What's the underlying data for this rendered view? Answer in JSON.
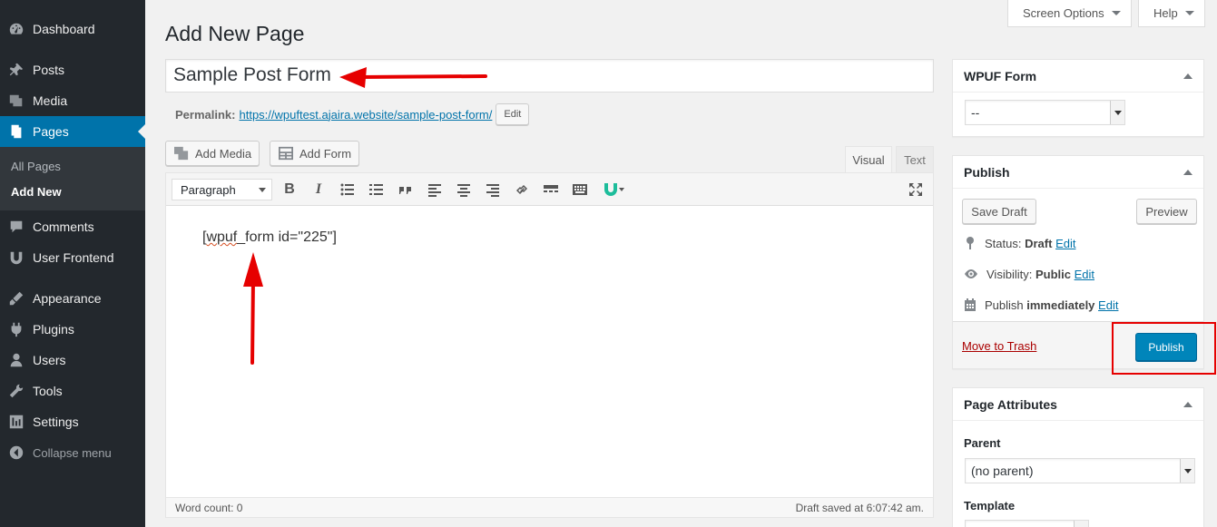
{
  "sidebar": {
    "items": [
      {
        "label": "Dashboard",
        "icon": "dashboard-icon"
      },
      {
        "label": "Posts",
        "icon": "pin-icon"
      },
      {
        "label": "Media",
        "icon": "media-icon"
      },
      {
        "label": "Pages",
        "icon": "pages-icon",
        "current": true
      },
      {
        "label": "Comments",
        "icon": "comments-icon"
      },
      {
        "label": "User Frontend",
        "icon": "user-frontend-icon"
      },
      {
        "label": "Appearance",
        "icon": "appearance-icon"
      },
      {
        "label": "Plugins",
        "icon": "plugins-icon"
      },
      {
        "label": "Users",
        "icon": "users-icon"
      },
      {
        "label": "Tools",
        "icon": "tools-icon"
      },
      {
        "label": "Settings",
        "icon": "settings-icon"
      },
      {
        "label": "Collapse menu",
        "icon": "collapse-icon"
      }
    ],
    "submenu": [
      "All Pages",
      "Add New"
    ]
  },
  "screen_meta": {
    "screen_options": "Screen Options",
    "help": "Help"
  },
  "page": {
    "title": "Add New Page",
    "post_title": "Sample Post Form",
    "permalink_label": "Permalink:",
    "permalink_url": "https://wpuftest.ajaira.website/sample-post-form/",
    "edit_label": "Edit"
  },
  "editor": {
    "add_media": "Add Media",
    "add_form": "Add Form",
    "tab_visual": "Visual",
    "tab_text": "Text",
    "format": "Paragraph",
    "content_pre": "[",
    "content_spell": "wpuf",
    "content_post": "_form id=\"225\"]",
    "word_count": "Word count: 0",
    "draft_saved": "Draft saved at 6:07:42 am."
  },
  "wpuf_box": {
    "title": "WPUF Form",
    "selected": "--"
  },
  "publish_box": {
    "title": "Publish",
    "save_draft": "Save Draft",
    "preview": "Preview",
    "status_label": "Status:",
    "status_value": "Draft",
    "visibility_label": "Visibility:",
    "visibility_value": "Public",
    "publish_label": "Publish",
    "publish_value": "immediately",
    "edit": "Edit",
    "trash": "Move to Trash",
    "publish_button": "Publish"
  },
  "attributes_box": {
    "title": "Page Attributes",
    "parent_label": "Parent",
    "parent_value": "(no parent)",
    "template_label": "Template"
  },
  "colors": {
    "accent": "#0073aa",
    "sidebar": "#23282d",
    "annotation": "#e60000"
  }
}
